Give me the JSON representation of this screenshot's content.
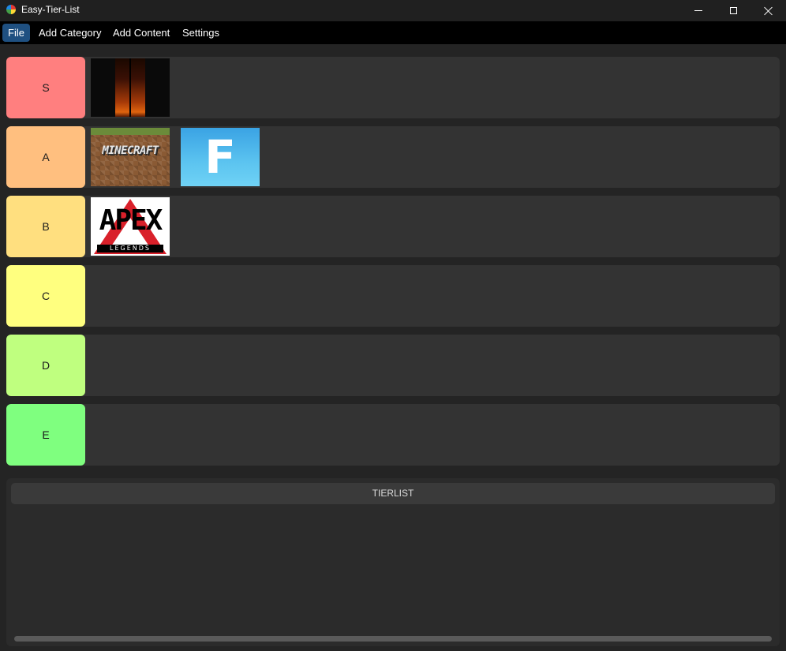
{
  "window": {
    "title": "Easy-Tier-List",
    "icon": "app-icon"
  },
  "menu": {
    "items": [
      {
        "label": "File",
        "active": true
      },
      {
        "label": "Add Category",
        "active": false
      },
      {
        "label": "Add Content",
        "active": false
      },
      {
        "label": "Settings",
        "active": false
      }
    ]
  },
  "tiers": [
    {
      "label": "S",
      "color": "#ff7f7f",
      "items": [
        "dark-game-thumbnail"
      ]
    },
    {
      "label": "A",
      "color": "#ffbf7f",
      "items": [
        "minecraft-thumbnail",
        "fortnite-thumbnail"
      ]
    },
    {
      "label": "B",
      "color": "#ffdf7f",
      "items": [
        "apex-legends-thumbnail"
      ]
    },
    {
      "label": "C",
      "color": "#ffff7f",
      "items": []
    },
    {
      "label": "D",
      "color": "#bfff7f",
      "items": []
    },
    {
      "label": "E",
      "color": "#7fff7f",
      "items": []
    }
  ],
  "thumbnails": {
    "minecraft_text": "MINECRAFT",
    "fortnite_text": "F",
    "apex_text": "APEX",
    "apex_subtext": "LEGENDS"
  },
  "panel": {
    "tab_label": "TIERLIST"
  }
}
